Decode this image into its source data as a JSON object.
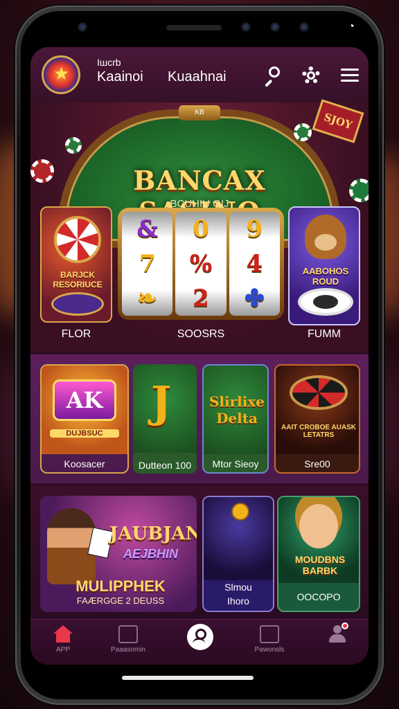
{
  "header": {
    "brand_small": "Iшcrb",
    "brand_name": "Kaainoi",
    "title": "Kuaahnai"
  },
  "hero": {
    "crown": "KB",
    "title": "BANCAX SASINO",
    "subtitle": "BCUHIU OIJ",
    "sign": "SJOY",
    "flor_title": "BARJCK RESORIUCE",
    "fumm_title": "AABOHOS ROUD",
    "labels": {
      "flor": "FLOR",
      "slots": "SOOSRS",
      "fumm": "FUMM"
    },
    "reels": [
      [
        "&",
        "7",
        "❧"
      ],
      [
        "0",
        "%",
        "2"
      ],
      [
        "9",
        "4",
        "✤"
      ]
    ]
  },
  "row2": [
    {
      "art": "AK",
      "sub": "DUJBSUC",
      "caption": "Koosacer"
    },
    {
      "art": "J",
      "caption": "Dutteon 100"
    },
    {
      "art": "Slirlixe Delta",
      "caption": "Mtor Sieoy"
    },
    {
      "art": "AAIT CROBOE AUASK LETATRS",
      "caption": "Sre00"
    }
  ],
  "promo": {
    "title": "JAUBJANO",
    "subtitle": "AEJBHIN",
    "main": "MULIPPHEK",
    "foot": "FAÆRGGE 2 DEUSS"
  },
  "game1": {
    "caption1": "Slmou",
    "caption2": "Ihoro"
  },
  "game2": {
    "art": "MOUDBNS BARBK",
    "caption": "OOCOPO"
  },
  "nav": {
    "app": "APP",
    "payments": "Paaasomin",
    "promos": "Pawonsls"
  },
  "colors": {
    "accent": "#e8384a",
    "gold": "#ffd86a",
    "panel": "#5c1f5c"
  }
}
